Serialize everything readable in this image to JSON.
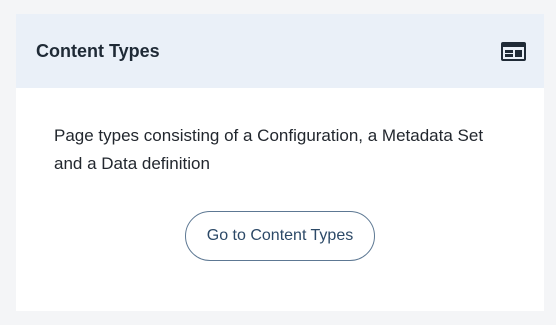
{
  "card": {
    "title": "Content Types",
    "icon": "layout-grid-icon",
    "description": "Page types consisting of a Configuration, a Metadata Set and a Data definition",
    "button_label": "Go to Content Types"
  },
  "colors": {
    "header_background": "#eaf0f8",
    "button_border": "#5d7893",
    "button_text": "#2c4967"
  }
}
